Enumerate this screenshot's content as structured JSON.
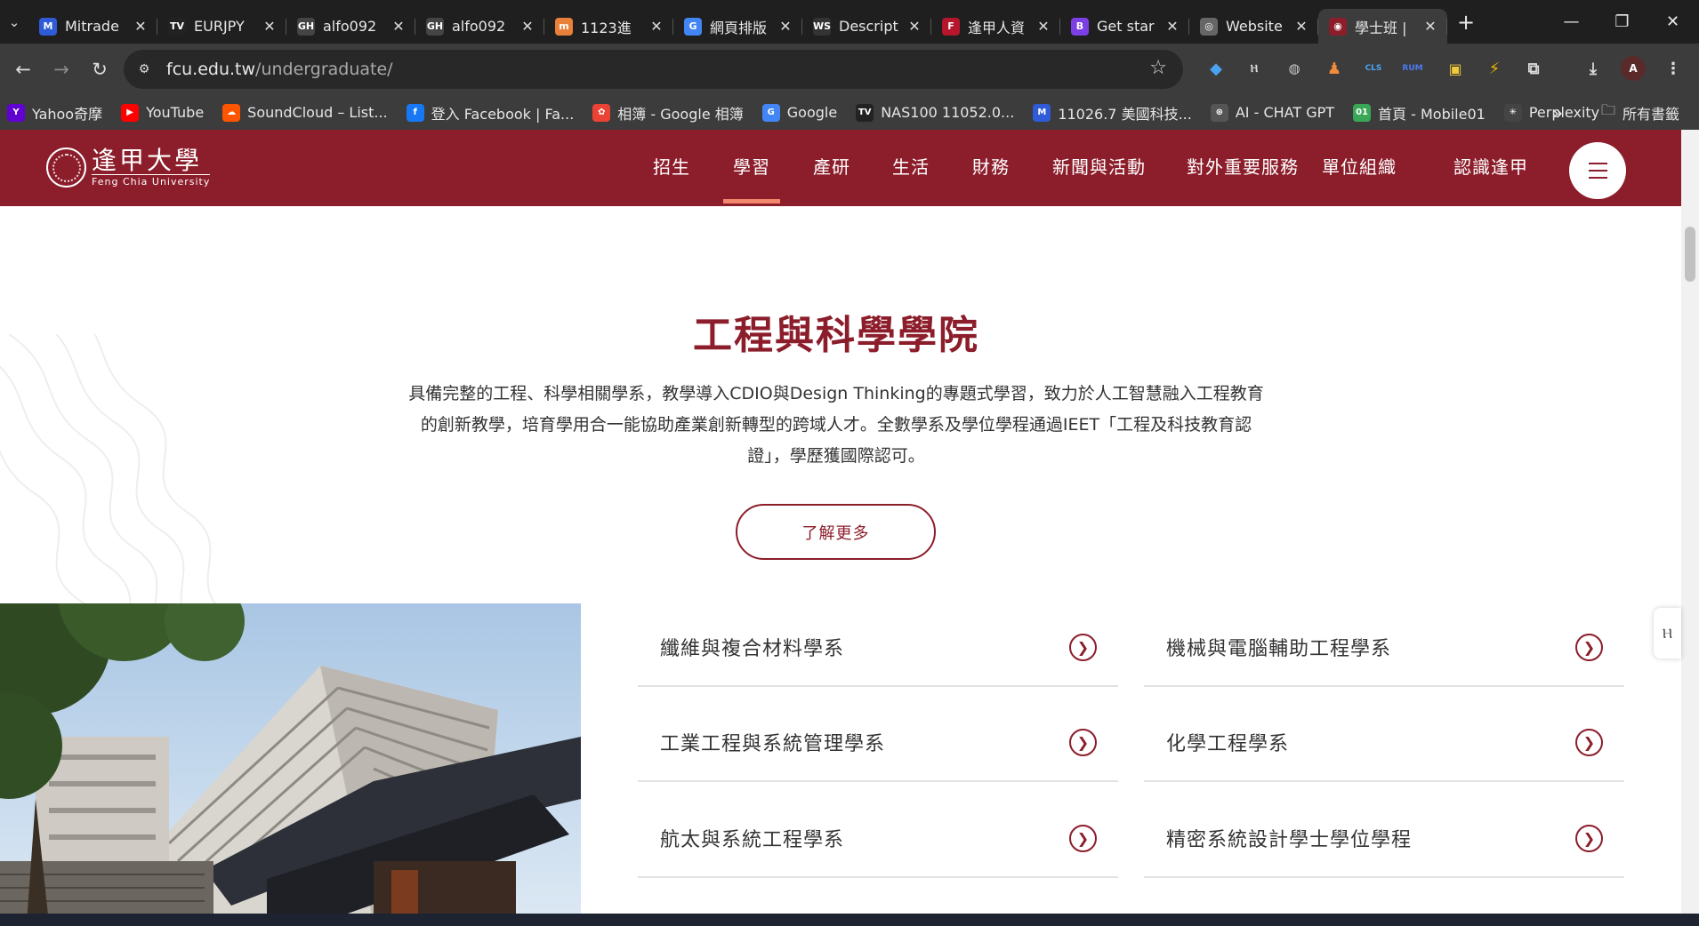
{
  "browser": {
    "tabs": [
      {
        "title": "Mitrade",
        "icon": "M",
        "color": "#2f5bd7",
        "active": false
      },
      {
        "title": "EURJPY",
        "icon": "TV",
        "color": "#222222",
        "active": false
      },
      {
        "title": "alfo092",
        "icon": "GH",
        "color": "#444444",
        "active": false
      },
      {
        "title": "alfo092",
        "icon": "GH",
        "color": "#444444",
        "active": false
      },
      {
        "title": "1123進",
        "icon": "m",
        "color": "#e8803a",
        "active": false
      },
      {
        "title": "網頁排版",
        "icon": "G",
        "color": "#4285f4",
        "active": false
      },
      {
        "title": "Descript",
        "icon": "WS",
        "color": "#333333",
        "active": false
      },
      {
        "title": "逢甲人資",
        "icon": "F",
        "color": "#b5162c",
        "active": false
      },
      {
        "title": "Get star",
        "icon": "B",
        "color": "#7b3fe4",
        "active": false
      },
      {
        "title": "Website",
        "icon": "◎",
        "color": "#666666",
        "active": false
      },
      {
        "title": "學士班 |",
        "icon": "◉",
        "color": "#8c1d2b",
        "active": true
      }
    ],
    "new_tab": "+",
    "window": {
      "minimize": "—",
      "restore": "❐",
      "close": "✕"
    },
    "url": {
      "host": "fcu.edu.tw",
      "path": "/undergraduate/"
    },
    "bookmarks": [
      {
        "label": "Yahoo奇摩",
        "icon": "Y",
        "color": "#6001d2"
      },
      {
        "label": "YouTube",
        "icon": "▶",
        "color": "#ff0000"
      },
      {
        "label": "SoundCloud – List...",
        "icon": "☁",
        "color": "#ff5500"
      },
      {
        "label": "登入 Facebook | Fa...",
        "icon": "f",
        "color": "#1877f2"
      },
      {
        "label": "相簿 - Google 相簿",
        "icon": "✿",
        "color": "#ea4335"
      },
      {
        "label": "Google",
        "icon": "G",
        "color": "#4285f4"
      },
      {
        "label": "NAS100 11052.0...",
        "icon": "TV",
        "color": "#222222"
      },
      {
        "label": "11026.7 美國科技...",
        "icon": "M",
        "color": "#2f5bd7"
      },
      {
        "label": "AI - CHAT GPT",
        "icon": "⊛",
        "color": "#555555"
      },
      {
        "label": "首頁 - Mobile01",
        "icon": "01",
        "color": "#3aa757"
      },
      {
        "label": "Perplexity",
        "icon": "✳",
        "color": "#444444"
      }
    ],
    "bookmarks_overflow": "»",
    "all_bookmarks": "所有書籤"
  },
  "site": {
    "logo": {
      "zh": "逢甲大學",
      "en": "Feng Chia University"
    },
    "menu": [
      {
        "label": "招生",
        "active": false
      },
      {
        "label": "學習",
        "active": true
      },
      {
        "label": "產研",
        "active": false
      },
      {
        "label": "生活",
        "active": false
      },
      {
        "label": "財務",
        "active": false
      },
      {
        "label": "新聞與活動",
        "active": false
      },
      {
        "label": "對外重要服務",
        "active": false
      },
      {
        "label": "單位組織",
        "active": false
      },
      {
        "label": "認識逢甲",
        "active": false
      }
    ]
  },
  "section": {
    "title": "工程與科學學院",
    "description": "具備完整的工程、科學相關學系，教學導入CDIO與Design Thinking的專題式學習，致力於人工智慧融入工程教育的創新教學，培育學用合一能協助產業創新轉型的跨域人才。全數學系及學位學程通過IEET「工程及科技教育認證」，學歷獲國際認可。",
    "cta": "了解更多",
    "departments": [
      "纖維與複合材料學系",
      "機械與電腦輔助工程學系",
      "工業工程與系統管理學系",
      "化學工程學系",
      "航太與系統工程學系",
      "精密系統設計學士學位學程"
    ]
  },
  "colors": {
    "brand": "#8c1d2b",
    "accent": "#f3876d"
  }
}
